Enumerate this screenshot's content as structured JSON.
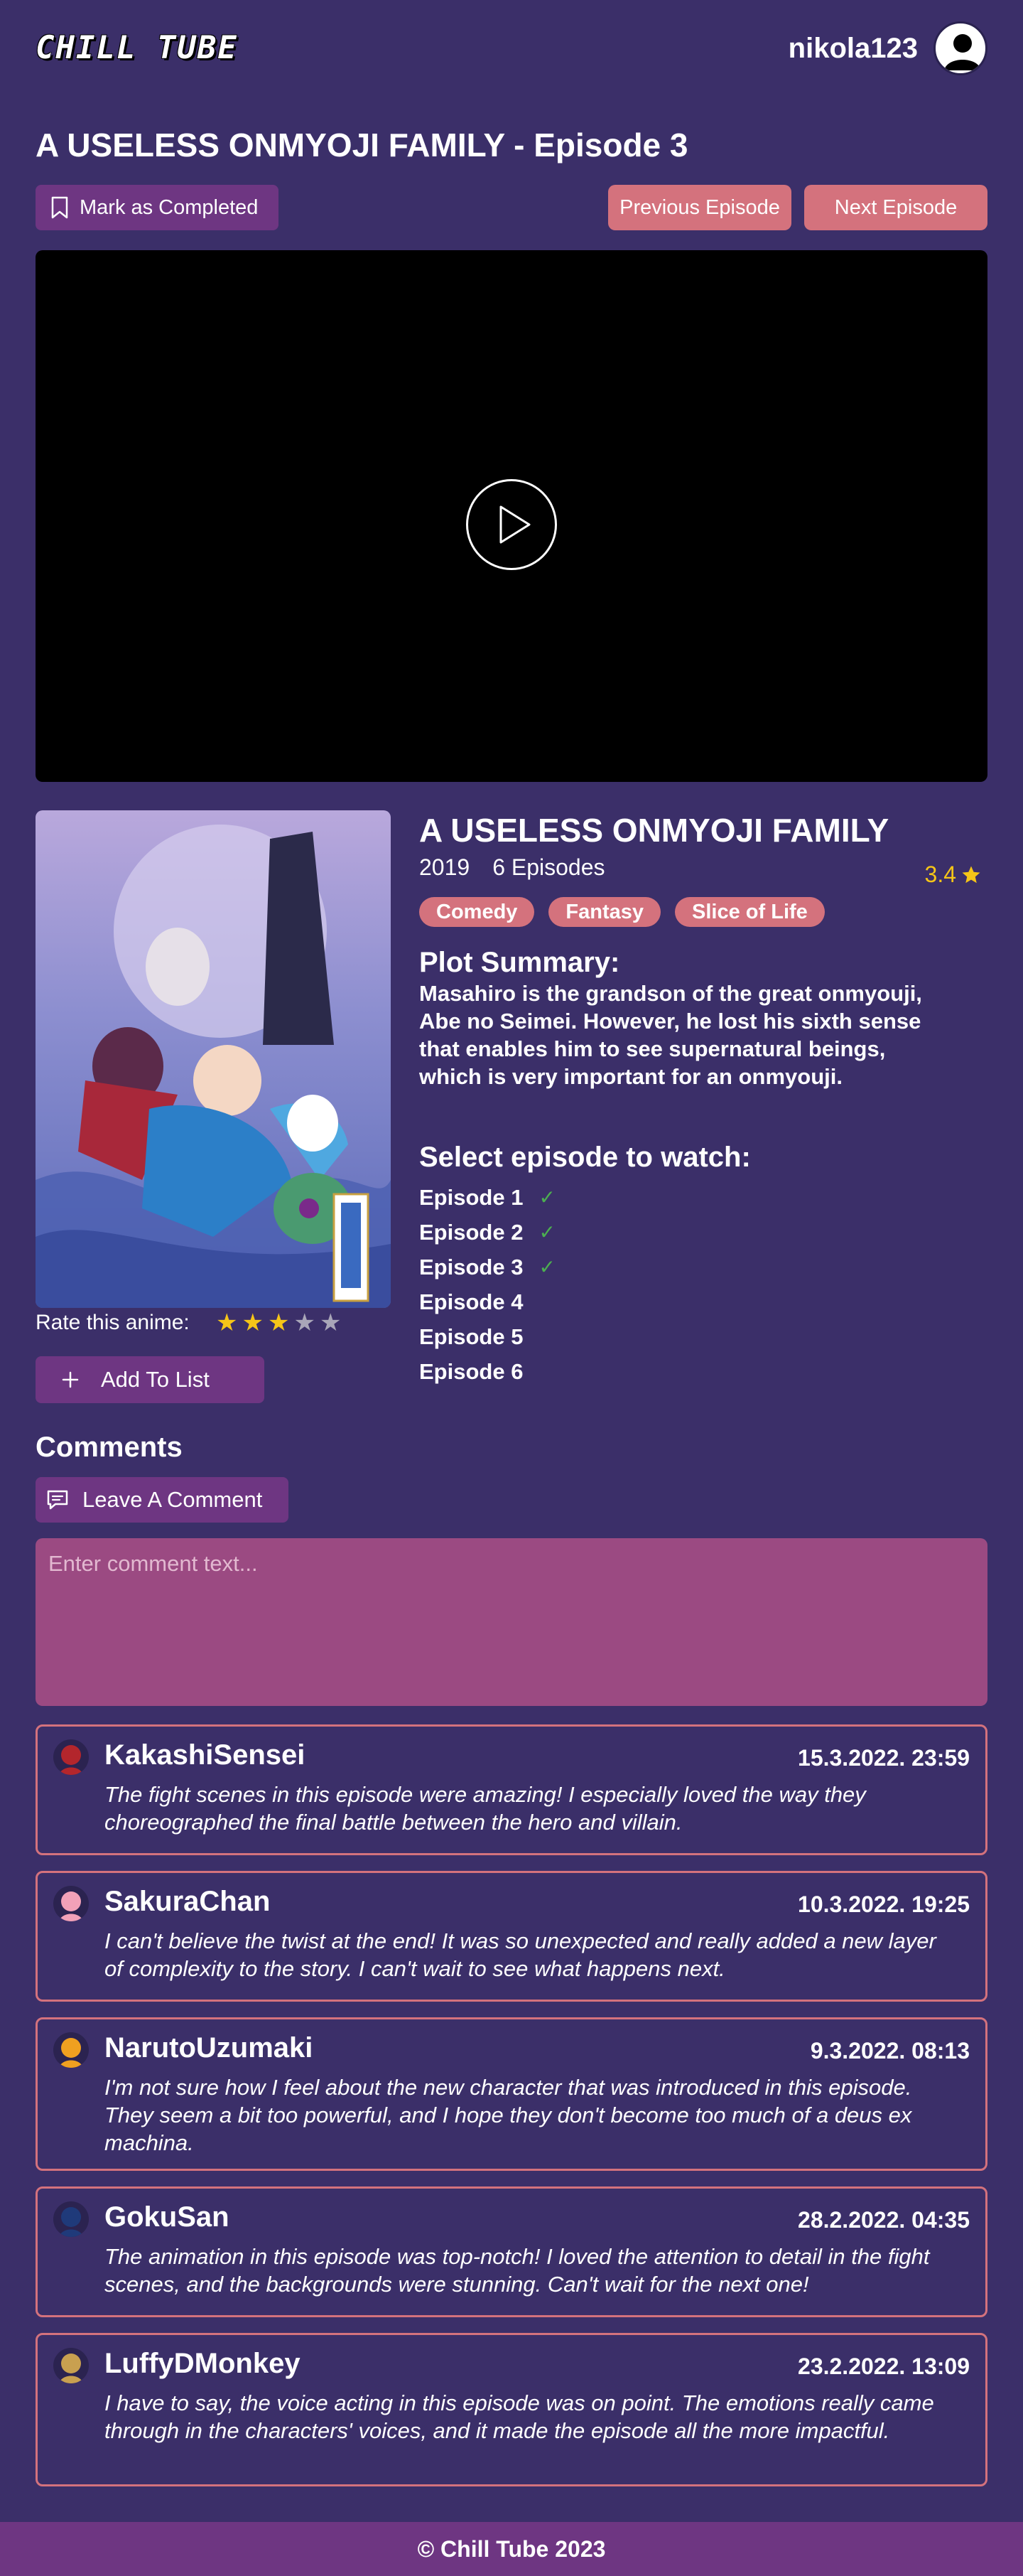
{
  "header": {
    "logo": "CHILL TUBE",
    "username": "nikola123"
  },
  "episode": {
    "page_title": "A USELESS ONMYOJI FAMILY - Episode 3",
    "mark_completed_label": "Mark as Completed",
    "prev_label": "Previous Episode",
    "next_label": "Next Episode"
  },
  "anime": {
    "title": "A USELESS ONMYOJI FAMILY",
    "year": "2019",
    "episodes_count": "6 Episodes",
    "rating": "3.4",
    "genres": [
      "Comedy",
      "Fantasy",
      "Slice of Life"
    ],
    "plot_heading": "Plot Summary:",
    "plot": "Masahiro is the grandson of the great onmyouji, Abe no Seimei. However, he lost his sixth sense that enables him to see supernatural beings, which is very important for an onmyouji.",
    "select_heading": "Select episode to watch:",
    "episodes": [
      {
        "label": "Episode 1",
        "watched": true
      },
      {
        "label": "Episode 2",
        "watched": true
      },
      {
        "label": "Episode 3",
        "watched": true
      },
      {
        "label": "Episode 4",
        "watched": false
      },
      {
        "label": "Episode 5",
        "watched": false
      },
      {
        "label": "Episode 6",
        "watched": false
      }
    ],
    "rate_label": "Rate this anime:",
    "user_rating": 3,
    "max_rating": 5,
    "add_to_list_label": "Add To List"
  },
  "comments": {
    "heading": "Comments",
    "leave_label": "Leave A Comment",
    "placeholder": "Enter comment text...",
    "items": [
      {
        "user": "KakashiSensei",
        "date": "15.3.2022. 23:59",
        "text": "The fight scenes in this episode were amazing! I especially loved the way they choreographed the final battle between the hero and villain.",
        "avatar_color": "#b3262c"
      },
      {
        "user": "SakuraChan",
        "date": "10.3.2022. 19:25",
        "text": "I can't believe the twist at the end! It was so unexpected and really added a new layer of complexity to the story. I can't wait to see what happens next.",
        "avatar_color": "#f2a1b8"
      },
      {
        "user": "NarutoUzumaki",
        "date": "9.3.2022. 08:13",
        "text": "I'm not sure how I feel about the new character that was introduced in this episode. They seem a bit too powerful, and I hope they don't become too much of a deus ex machina.",
        "avatar_color": "#f0a020"
      },
      {
        "user": "GokuSan",
        "date": "28.2.2022. 04:35",
        "text": "The animation in this episode was top-notch! I loved the attention to detail in the fight scenes, and the backgrounds were stunning. Can't wait for the next one!",
        "avatar_color": "#1f3a7a"
      },
      {
        "user": "LuffyDMonkey",
        "date": "23.2.2022. 13:09",
        "text": "I have to say, the voice acting in this episode was on point. The emotions really came through in the characters' voices, and it made the episode all the more impactful.",
        "avatar_color": "#c8a050"
      }
    ]
  },
  "footer": {
    "text": "© Chill Tube 2023"
  },
  "colors": {
    "background": "#3b2f69",
    "accent": "#d4727d",
    "button": "#6e3682",
    "star": "#f5c518",
    "check": "#4caf50"
  }
}
